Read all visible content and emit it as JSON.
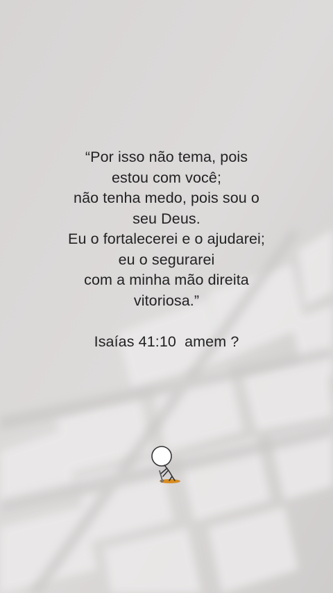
{
  "verse": {
    "lines": [
      "“Por isso não tema, pois",
      "estou com você;",
      "não tenha medo, pois sou o",
      "seu Deus.",
      "Eu o fortalecerei e o ajudarei;",
      "eu o segurarei",
      "com a minha mão direita",
      "vitoriosa.”"
    ],
    "reference": "Isaías 41:10  amem ?"
  },
  "colors": {
    "background": "#dcd9d9",
    "text": "#222222",
    "accent": "#d98c1e"
  },
  "icons": {
    "mascot": "stick-figure-with-shovel-icon"
  }
}
